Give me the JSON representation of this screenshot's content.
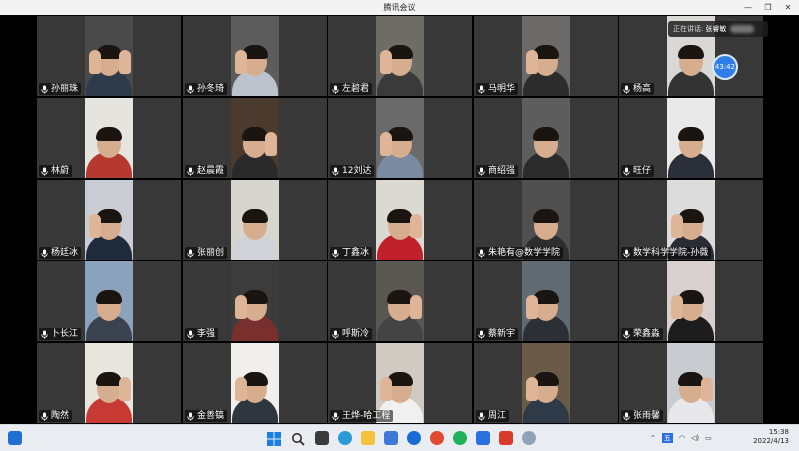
{
  "window": {
    "title": "腾讯会议",
    "controls": {
      "minimize": "—",
      "restore": "❐",
      "close": "✕"
    }
  },
  "speaking": {
    "prefix": "正在讲话:",
    "name": "张睿敏"
  },
  "timer": {
    "value": "43:42"
  },
  "participants": [
    {
      "name": "孙丽珠"
    },
    {
      "name": "孙冬琦"
    },
    {
      "name": "左碧君"
    },
    {
      "name": "马明华"
    },
    {
      "name": "杨高"
    },
    {
      "name": "林蔚"
    },
    {
      "name": "赵晨霞"
    },
    {
      "name": "12刘达"
    },
    {
      "name": "商绍强"
    },
    {
      "name": "旺仔"
    },
    {
      "name": "杨廷冰"
    },
    {
      "name": "张丽创"
    },
    {
      "name": "丁鑫冰"
    },
    {
      "name": "朱艳有@数学学院"
    },
    {
      "name": "数学科学学院-孙薇"
    },
    {
      "name": "卜长江"
    },
    {
      "name": "李强"
    },
    {
      "name": "呼斯冷"
    },
    {
      "name": "蔡新宇"
    },
    {
      "name": "荣鑫淼"
    },
    {
      "name": "陶然"
    },
    {
      "name": "金善镐"
    },
    {
      "name": "王烨-哈工程"
    },
    {
      "name": "周江"
    },
    {
      "name": "张雨馨"
    }
  ],
  "taskbar": {
    "tray": {
      "lang1": "中",
      "lang2": "五"
    },
    "clock": {
      "time": "15:38",
      "date": "2022/4/13"
    }
  },
  "colors": {
    "accent": "#2f7de8",
    "mic_on": "#ffffff"
  }
}
